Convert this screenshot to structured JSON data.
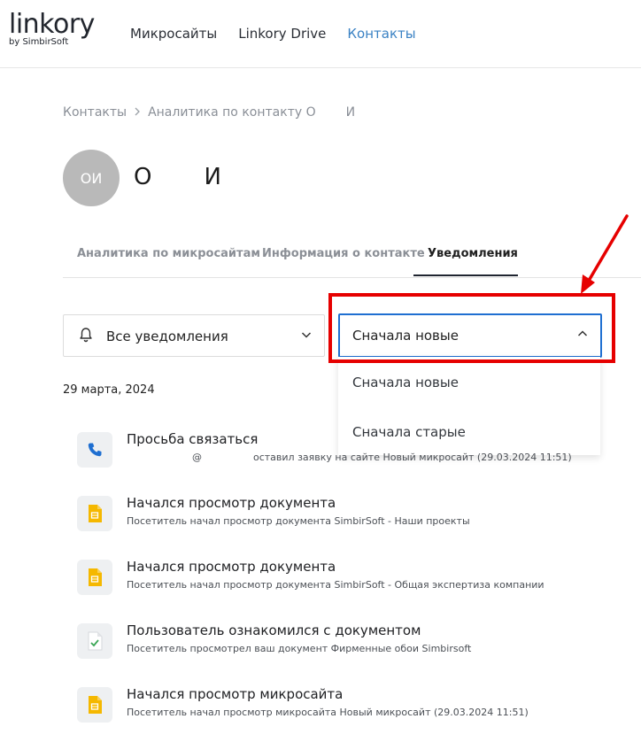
{
  "header": {
    "logo_text": "linkory",
    "logo_sub": "by SimbirSoft",
    "nav": [
      {
        "label": "Микросайты"
      },
      {
        "label": "Linkory Drive"
      },
      {
        "label": "Контакты"
      }
    ]
  },
  "breadcrumb": {
    "root": "Контакты",
    "current": "Аналитика по контакту О",
    "current_tail": "И"
  },
  "contact": {
    "initials": "ОИ",
    "first_initial": "О",
    "second_initial": "И"
  },
  "tabs": [
    {
      "label": "Аналитика по микросайтам"
    },
    {
      "label": "Информация о контакте"
    },
    {
      "label": "Уведомления"
    }
  ],
  "filter": {
    "label": "Все уведомления"
  },
  "sort": {
    "selected": "Сначала новые",
    "options": [
      "Сначала новые",
      "Сначала старые"
    ]
  },
  "date_group": "29 марта, 2024",
  "notifications": [
    {
      "title": "Просьба связаться",
      "desc_at": "@",
      "desc": "оставил заявку на сайте Новый микросайт (29.03.2024 11:51)",
      "icon": "phone-icon"
    },
    {
      "title": "Начался просмотр документа",
      "desc": "Посетитель начал просмотр документа SimbirSoft - Наши проекты",
      "icon": "document-icon"
    },
    {
      "title": "Начался просмотр документа",
      "desc": "Посетитель начал просмотр документа SimbirSoft - Общая экспертиза компании",
      "icon": "document-icon"
    },
    {
      "title": "Пользователь ознакомился с документом",
      "desc": "Посетитель просмотрел ваш документ Фирменные обои Simbirsoft",
      "icon": "document-check-icon"
    },
    {
      "title": "Начался просмотр микросайта",
      "desc": "Посетитель начал просмотр микросайта Новый микросайт (29.03.2024 11:51)",
      "icon": "document-icon"
    }
  ],
  "colors": {
    "accent": "#1f6fd1",
    "highlight": "#e60000",
    "doc_yellow": "#f5b800"
  }
}
